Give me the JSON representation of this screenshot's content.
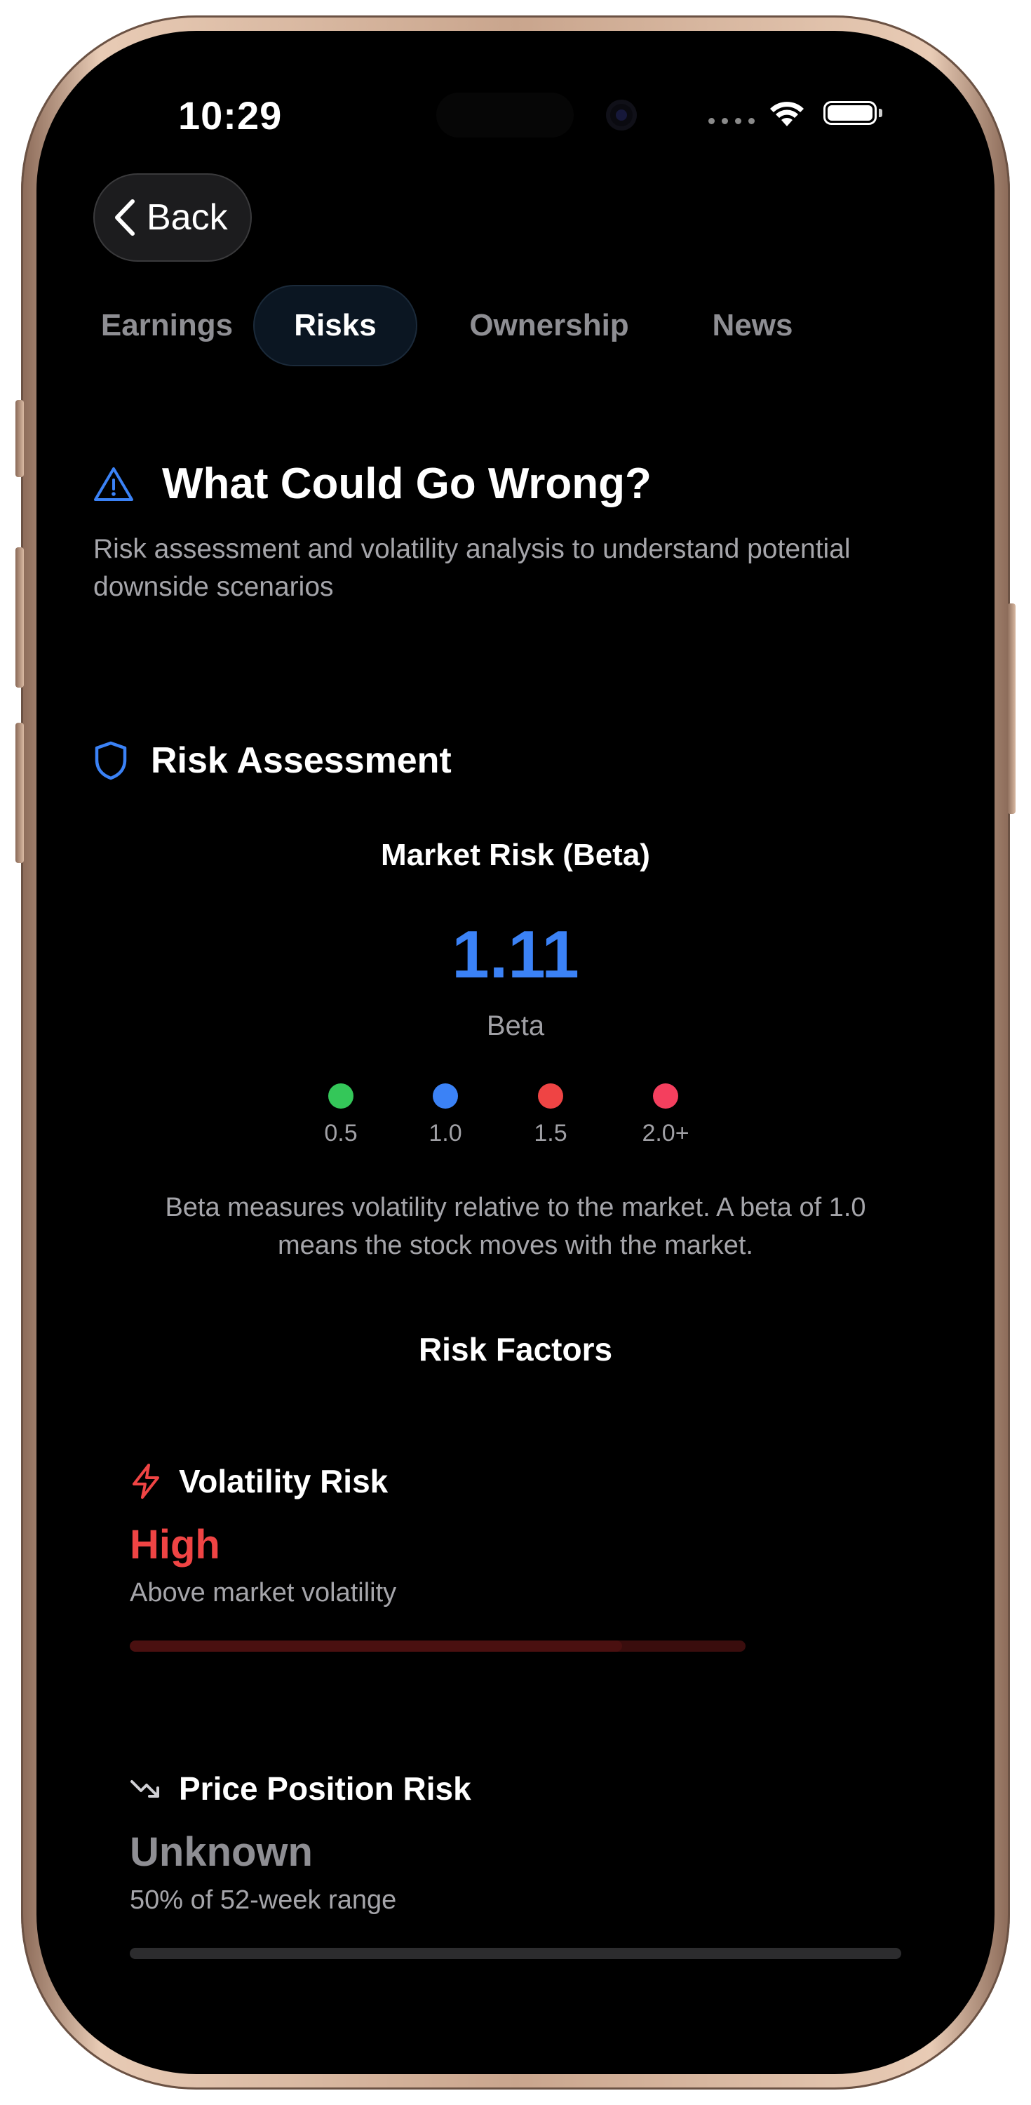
{
  "status_bar": {
    "time": "10:29"
  },
  "nav": {
    "back_label": "Back"
  },
  "tabs": [
    {
      "label": "Earnings",
      "active": false
    },
    {
      "label": "Risks",
      "active": true
    },
    {
      "label": "Ownership",
      "active": false
    },
    {
      "label": "News",
      "active": false
    }
  ],
  "page": {
    "title": "What Could Go Wrong?",
    "subtitle": "Risk assessment and volatility analysis to understand potential downside scenarios",
    "title_icon": "warning-triangle-icon"
  },
  "risk_assessment": {
    "section_title": "Risk Assessment",
    "section_icon": "shield-icon",
    "market_risk_label": "Market Risk (Beta)",
    "beta_value": "1.11",
    "beta_label": "Beta",
    "beta_color": "#3b82f6",
    "scale": [
      {
        "label": "0.5",
        "color": "#34c759"
      },
      {
        "label": "1.0",
        "color": "#3b82f6"
      },
      {
        "label": "1.5",
        "color": "#ef4444"
      },
      {
        "label": "2.0+",
        "color": "#f43f5e"
      }
    ],
    "note": "Beta measures volatility relative to the market. A beta of 1.0 means the stock moves with the market."
  },
  "risk_factors": {
    "title": "Risk Factors",
    "items": [
      {
        "title": "Volatility Risk",
        "icon": "lightning-icon",
        "level": "High",
        "level_color": "#ef4444",
        "description": "Above market volatility",
        "progress": 0.8
      },
      {
        "title": "Price Position Risk",
        "icon": "trending-down-icon",
        "level": "Unknown",
        "level_color": "#8e8e93",
        "description": "50% of 52-week range",
        "progress": 0
      }
    ]
  }
}
